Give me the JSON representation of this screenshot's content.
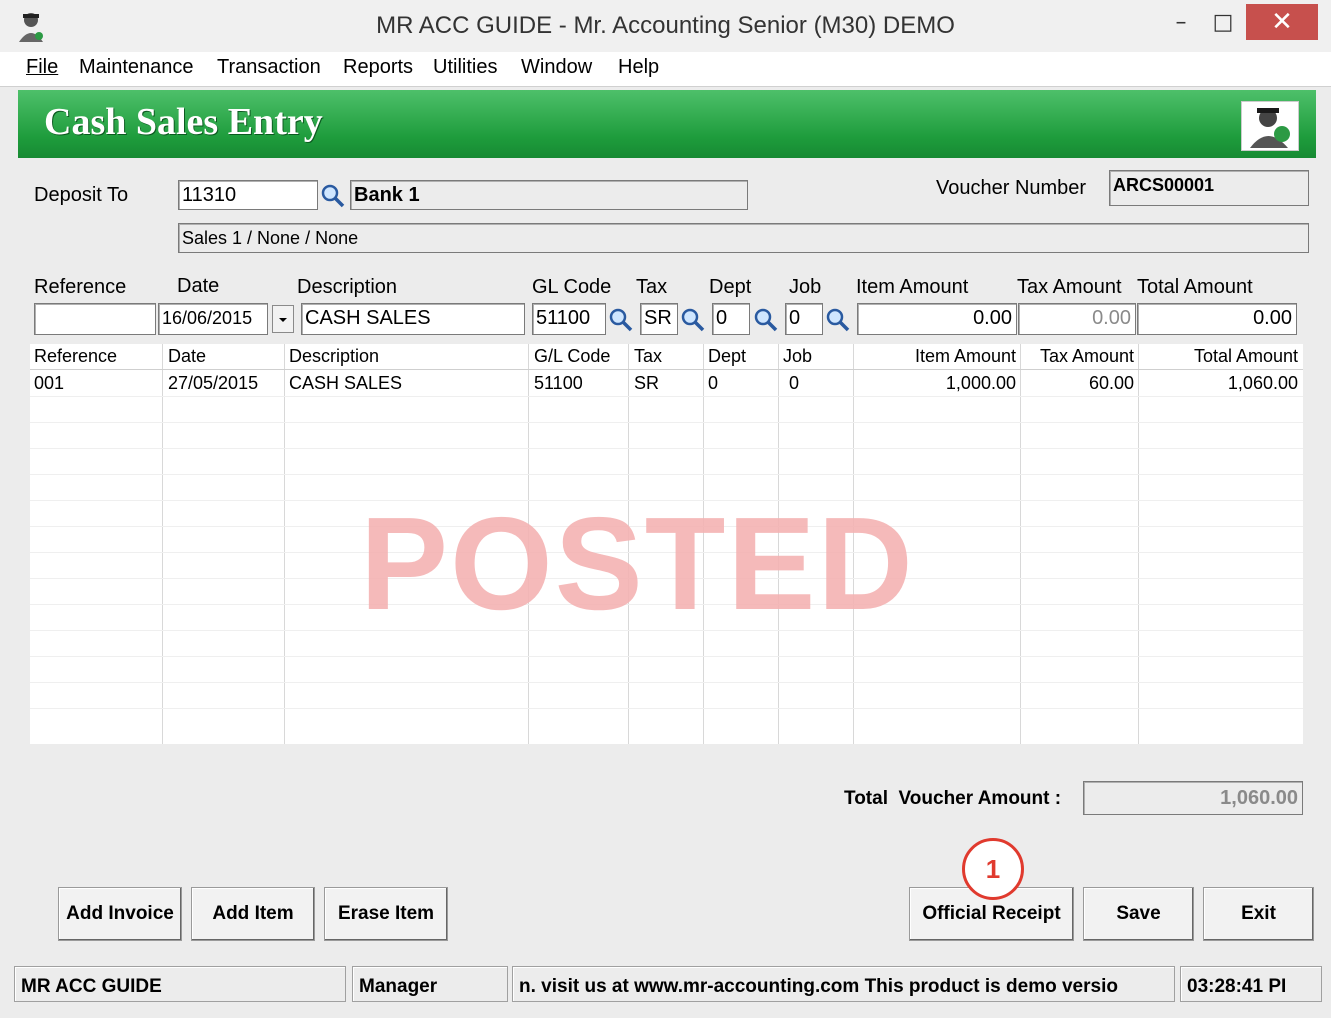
{
  "window": {
    "title": "MR ACC GUIDE - Mr. Accounting Senior (M30) DEMO",
    "minimize_glyph": "–",
    "maximize_glyph": "□",
    "close_glyph": "✕"
  },
  "menu": [
    {
      "label": "File"
    },
    {
      "label": "Maintenance"
    },
    {
      "label": "Transaction"
    },
    {
      "label": "Reports"
    },
    {
      "label": "Utilities"
    },
    {
      "label": "Window"
    },
    {
      "label": "Help"
    }
  ],
  "banner": {
    "title": "Cash Sales Entry"
  },
  "header": {
    "deposit_to_label": "Deposit To",
    "deposit_to_code": "11310",
    "deposit_to_name": "Bank 1",
    "voucher_number_label": "Voucher Number",
    "voucher_number": "ARCS00001",
    "analysis": "Sales 1 / None / None"
  },
  "entry": {
    "labels": {
      "reference": "Reference",
      "date": "Date",
      "description": "Description",
      "gl_code": "GL Code",
      "tax": "Tax",
      "dept": "Dept",
      "job": "Job",
      "item_amount": "Item Amount",
      "tax_amount": "Tax Amount",
      "total_amount": "Total Amount"
    },
    "values": {
      "reference": "",
      "date": "16/06/2015",
      "description": "CASH SALES",
      "gl_code": "51100",
      "tax": "SR",
      "dept": "0",
      "job": "0",
      "item_amount": "0.00",
      "tax_amount": "0.00",
      "total_amount": "0.00"
    }
  },
  "grid": {
    "columns": [
      "Reference",
      "Date",
      "Description",
      "G/L Code",
      "Tax",
      "Dept",
      "Job",
      "Item Amount",
      "Tax Amount",
      "Total Amount"
    ],
    "rows": [
      {
        "reference": "001",
        "date": "27/05/2015",
        "description": "CASH SALES",
        "gl_code": "51100",
        "tax": "SR",
        "dept": "0",
        "job": "0",
        "item_amount": "1,000.00",
        "tax_amount": "60.00",
        "total_amount": "1,060.00"
      }
    ],
    "watermark": "POSTED",
    "watermark_color": "#f4b3b3"
  },
  "totals": {
    "label": "Total  Voucher Amount :",
    "value": "1,060.00"
  },
  "buttons": {
    "add_invoice": "Add Invoice",
    "add_item": "Add Item",
    "erase_item": "Erase Item",
    "official_receipt": "Official Receipt",
    "save": "Save",
    "exit": "Exit"
  },
  "annotation": {
    "number": "1",
    "color": "#e03a2e"
  },
  "status": {
    "company": "MR ACC GUIDE",
    "user": "Manager",
    "message": "n.  visit us at www.mr-accounting.com This product is demo versio",
    "time": "03:28:41 PI"
  },
  "colors": {
    "banner_green": "#1e9c3c",
    "close_red": "#c7504d"
  }
}
